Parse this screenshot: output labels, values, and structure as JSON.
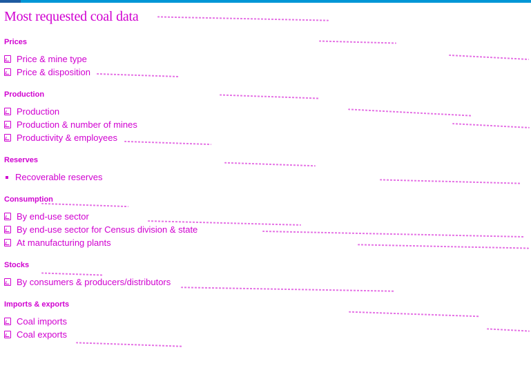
{
  "page": {
    "title": "Most requested coal data",
    "colors": {
      "accent": "#d000d0",
      "topbar": "#0096d6"
    }
  },
  "sections": [
    {
      "heading": "Prices",
      "items": [
        {
          "label": "Price & mine type",
          "icon": "pdf-icon"
        },
        {
          "label": "Price & disposition",
          "icon": "pdf-icon"
        }
      ]
    },
    {
      "heading": "Production",
      "items": [
        {
          "label": "Production",
          "icon": "pdf-icon"
        },
        {
          "label": "Production & number of mines",
          "icon": "pdf-icon"
        },
        {
          "label": "Productivity & employees",
          "icon": "pdf-icon"
        }
      ]
    },
    {
      "heading": "Reserves",
      "items": [
        {
          "label": "Recoverable reserves",
          "icon": "bullet-icon"
        }
      ]
    },
    {
      "heading": "Consumption",
      "items": [
        {
          "label": "By end-use sector",
          "icon": "pdf-icon"
        },
        {
          "label": "By end-use sector for Census division & state",
          "icon": "pdf-icon"
        },
        {
          "label": "At manufacturing plants",
          "icon": "pdf-icon"
        }
      ]
    },
    {
      "heading": "Stocks",
      "items": [
        {
          "label": "By consumers & producers/distributors",
          "icon": "pdf-icon"
        }
      ]
    },
    {
      "heading": "Imports & exports",
      "items": [
        {
          "label": "Coal imports",
          "icon": "pdf-icon"
        },
        {
          "label": "Coal exports",
          "icon": "pdf-icon"
        }
      ]
    }
  ]
}
